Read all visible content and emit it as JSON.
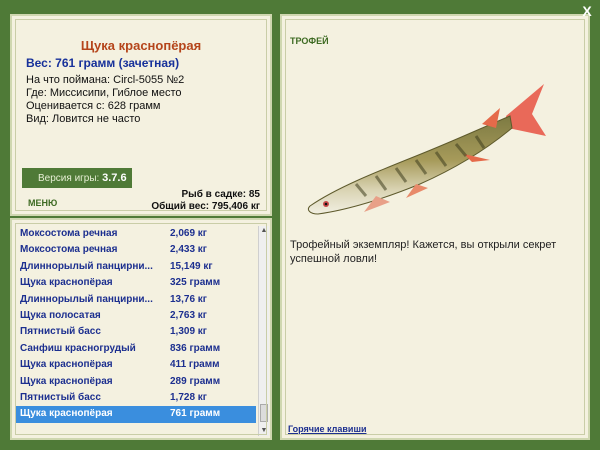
{
  "info": {
    "fish_name": "Щука краснопёрая",
    "weight_line": "Вес: 761 грамм (зачетная)",
    "caught_with": "На что поймана: Circl-5055 №2",
    "location": "Где: Миссисипи, Гиблое место",
    "rated_from": "Оценивается с: 628 грамм",
    "kind": "Вид: Ловится не часто",
    "version_label": "Версия игры:",
    "version_value": "3.7.6",
    "menu_label": "МЕНЮ",
    "stats_count": "Рыб в садке: 85",
    "stats_total": "Общий вес: 795,406 кг"
  },
  "catch_list": [
    {
      "name": "Моксостома речная",
      "weight": "2,069 кг"
    },
    {
      "name": "Моксостома речная",
      "weight": "2,433 кг"
    },
    {
      "name": "Длиннорылый панцирни...",
      "weight": "15,149 кг"
    },
    {
      "name": "Щука краснопёрая",
      "weight": "325 грамм"
    },
    {
      "name": "Длиннорылый панцирни...",
      "weight": "13,76 кг"
    },
    {
      "name": "Щука полосатая",
      "weight": "2,763 кг"
    },
    {
      "name": "Пятнистый басс",
      "weight": "1,309 кг"
    },
    {
      "name": "Санфиш красногрудый",
      "weight": "836 грамм"
    },
    {
      "name": "Щука краснопёрая",
      "weight": "411 грамм"
    },
    {
      "name": "Щука краснопёрая",
      "weight": "289 грамм"
    },
    {
      "name": "Пятнистый басс",
      "weight": "1,728 кг"
    },
    {
      "name": "Щука краснопёрая",
      "weight": "761 грамм",
      "selected": true
    }
  ],
  "trophy": {
    "label": "ТРОФЕЙ",
    "text": "Трофейный экземпляр! Кажется, вы открыли секрет успешной ловли!",
    "hotkeys": "Горячие клавиши"
  },
  "close_label": "X",
  "icons": {
    "close": "close-icon",
    "scroll_up": "arrow-up-icon",
    "scroll_down": "arrow-down-icon"
  },
  "colors": {
    "background": "#4f7a37",
    "panel": "#f4f1e0",
    "title": "#b5451b",
    "link": "#1c2f8f",
    "selection": "#3a8ede"
  }
}
